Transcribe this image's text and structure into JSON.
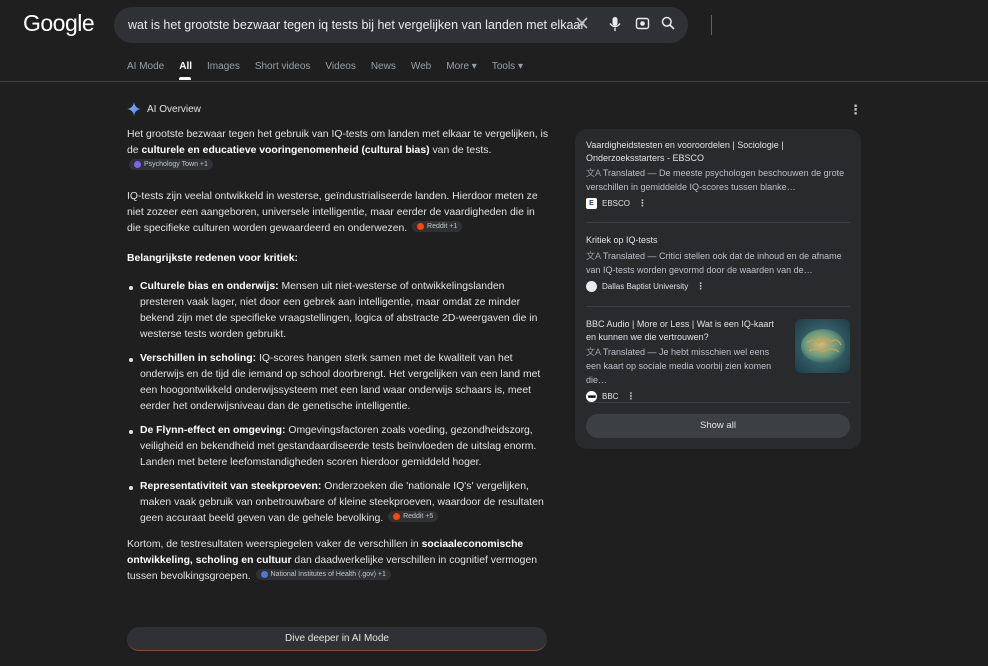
{
  "header": {
    "logo": "Google",
    "search_query": "wat is het grootste bezwaar tegen iq tests bij het vergelijken van landen met elkaar"
  },
  "tabs": [
    "AI Mode",
    "All",
    "Images",
    "Short videos",
    "Videos",
    "News",
    "Web",
    "More ▾",
    "Tools ▾"
  ],
  "ai_overview": {
    "label": "AI Overview",
    "p1_a": "Het grootste bezwaar tegen het gebruik van IQ-tests om landen met elkaar te vergelijken, is de ",
    "p1_b": "culturele en educatieve vooringenomenheid (cultural bias)",
    "p1_c": " van de tests.",
    "chip_psych": "Psychology Town +1",
    "p2": "IQ-tests zijn veelal ontwikkeld in westerse, geïndustrialiseerde landen. Hierdoor meten ze niet zozeer een aangeboren, universele intelligentie, maar eerder de vaardigheden die in die specifieke culturen worden gewaardeerd en onderwezen.",
    "chip_reddit1": "Reddit +1",
    "heading": "Belangrijkste redenen voor kritiek:",
    "reasons": [
      {
        "title": "Culturele bias en onderwijs:",
        "text": " Mensen uit niet-westerse of ontwikkelingslanden presteren vaak lager, niet door een gebrek aan intelligentie, maar omdat ze minder bekend zijn met de specifieke vraagstellingen, logica of abstracte 2D-weergaven die in westerse tests worden gebruikt."
      },
      {
        "title": "Verschillen in scholing:",
        "text": " IQ-scores hangen sterk samen met de kwaliteit van het onderwijs en de tijd die iemand op school doorbrengt. Het vergelijken van een land met een hoogontwikkeld onderwijssysteem met een land waar onderwijs schaars is, meet eerder het onderwijsniveau dan de genetische intelligentie."
      },
      {
        "title": "De Flynn-effect en omgeving:",
        "text": " Omgevingsfactoren zoals voeding, gezondheidszorg, veiligheid en bekendheid met gestandaardiseerde tests beïnvloeden de uitslag enorm. Landen met betere leefomstandigheden scoren hierdoor gemiddeld hoger."
      },
      {
        "title": "Representativiteit van steekproeven:",
        "text": " Onderzoeken die 'nationale IQ's' vergelijken, maken vaak gebruik van onbetrouwbare of kleine steekproeven, waardoor de resultaten geen accuraat beeld geven van de gehele bevolking."
      }
    ],
    "chip_reddit5": "Reddit +5",
    "p3_a": "Kortom, de testresultaten weerspiegelen vaker de verschillen in ",
    "p3_b": "sociaaleconomische ontwikkeling, scholing en cultuur",
    "p3_c": " dan daadwerkelijke verschillen in cognitief vermogen tussen bevolkingsgroepen.",
    "chip_nih": "National Institutes of Health (.gov) +1",
    "dive_button": "Dive deeper in AI Mode"
  },
  "sources": [
    {
      "title": "Vaardigheidstesten en vooroordelen | Sociologie | Onderzoeksstarters - EBSCO",
      "translated": "Translated",
      "snippet": " — De meeste psychologen beschouwen de grote verschillen in gemiddelde IQ-scores tussen blanke…",
      "site": "EBSCO"
    },
    {
      "title": "Kritiek op IQ-tests",
      "translated": "Translated",
      "snippet": " — Critici stellen ook dat de inhoud en de afname van IQ-tests worden gevormd door de waarden van de…",
      "site": "Dallas Baptist University"
    },
    {
      "title": "BBC Audio | More or Less | Wat is een IQ-kaart en kunnen we die vertrouwen?",
      "translated": "Translated",
      "snippet": " — Je hebt misschien wel eens een kaart op sociale media voorbij zien komen die…",
      "site": "BBC"
    }
  ],
  "show_all": "Show all",
  "colors": {
    "background": "#1f1f1f",
    "panel": "#282a2c",
    "chip": "#303134"
  }
}
